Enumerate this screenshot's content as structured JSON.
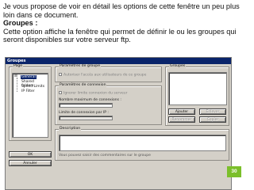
{
  "intro": {
    "line1": "Je vous propose de voir en détail les options de cette fenêtre un peu plus loin dans ce document.",
    "heading": "Groupes :",
    "line2": "Cette option affiche la fenêtre qui permet de définir le ou les groupes qui seront disponibles sur votre serveur ftp."
  },
  "dialog": {
    "title": "Groupes",
    "page_group": {
      "legend": "Page",
      "items": [
        "General",
        "Shared folders",
        "Speed Limits",
        "IP Filter"
      ],
      "selected_index": 0
    },
    "group_settings": {
      "legend": "Paramètres de groupe",
      "checkbox_label": "Autoriser l'accès aux utilisateurs de ce groupe"
    },
    "connection_settings": {
      "legend": "Paramètres de connexion",
      "checkbox_label": "Ignorer limite connexion du serveur",
      "max_connections_label": "Nombre maximum de connexions :",
      "ip_limit_label": "Limite de connexion par IP :"
    },
    "description": {
      "legend": "Description",
      "hint": "Vous pouvez saisir des commentaires sur le groupe"
    },
    "groups": {
      "legend": "Groupes",
      "buttons": {
        "add": "Ajouter",
        "remove": "Enlever",
        "rename": "Renommer",
        "copy": "Copier"
      }
    },
    "buttons": {
      "ok": "OK",
      "cancel": "Annuler"
    }
  },
  "slide_number": "30",
  "colors": {
    "accent_badge": "#7bbf2b",
    "titlebar": "#0a246a"
  }
}
